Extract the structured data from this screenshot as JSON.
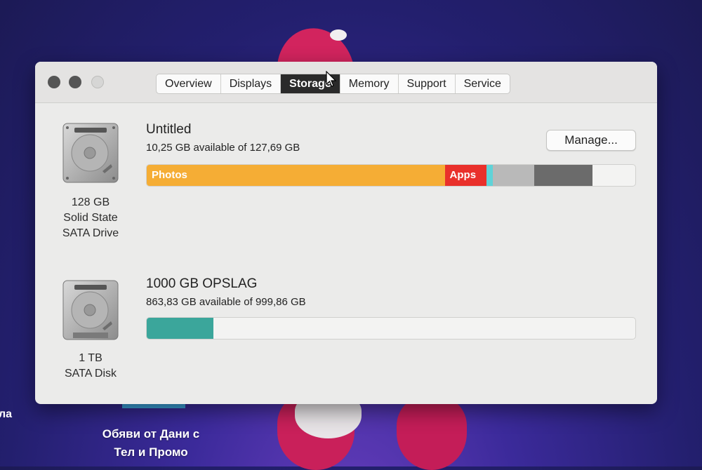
{
  "window": {
    "tabs": [
      {
        "label": "Overview",
        "selected": false
      },
      {
        "label": "Displays",
        "selected": false
      },
      {
        "label": "Storage",
        "selected": true
      },
      {
        "label": "Memory",
        "selected": false
      },
      {
        "label": "Support",
        "selected": false
      },
      {
        "label": "Service",
        "selected": false
      }
    ]
  },
  "drives": [
    {
      "volume_name": "Untitled",
      "available_text": "10,25 GB available of 127,69 GB",
      "caption_lines": [
        "128 GB",
        "Solid State",
        "SATA Drive"
      ],
      "manage_label": "Manage...",
      "icon": "hard-drive-icon",
      "usage_segments": [
        {
          "label": "Photos",
          "fraction": 0.61,
          "color": "#f5ad35"
        },
        {
          "label": "Apps",
          "fraction": 0.085,
          "color": "#e9302b"
        },
        {
          "label": "",
          "fraction": 0.013,
          "color": "#5fd3d8"
        },
        {
          "label": "",
          "fraction": 0.085,
          "color": "#b9b9b9"
        },
        {
          "label": "",
          "fraction": 0.12,
          "color": "#6b6b6b"
        }
      ]
    },
    {
      "volume_name": "1000 GB OPSLAG",
      "available_text": "863,83 GB available of 999,86 GB",
      "caption_lines": [
        "1 TB",
        "SATA Disk"
      ],
      "icon": "hard-drive-icon",
      "usage_segments": [
        {
          "label": "",
          "fraction": 0.137,
          "color": "#3ba69b"
        }
      ]
    }
  ],
  "desktop": {
    "side_text": "ла",
    "label_lines": [
      "Обяви от Дани с",
      "Тел и Промо"
    ]
  },
  "colors": {
    "selected_tab": "#2a2a2a",
    "window_bg": "#ebebea"
  }
}
